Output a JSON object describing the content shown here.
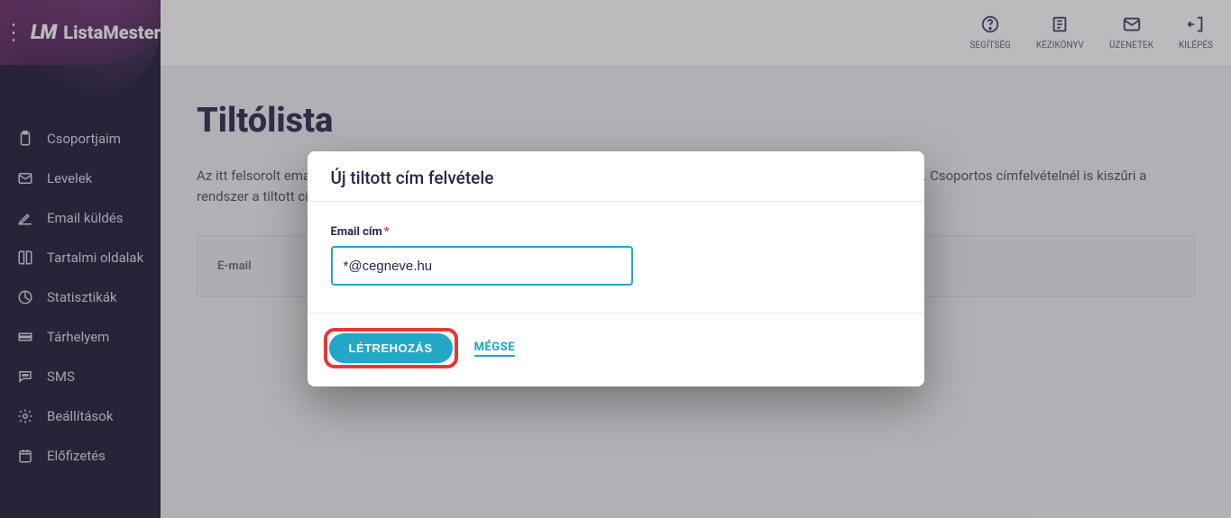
{
  "brand": {
    "logo_text": "LM",
    "name": "ListaMester"
  },
  "sidebar": {
    "items": [
      {
        "label": "Csoportjaim",
        "icon": "clipboard"
      },
      {
        "label": "Levelek",
        "icon": "mail"
      },
      {
        "label": "Email küldés",
        "icon": "send"
      },
      {
        "label": "Tartalmi oldalak",
        "icon": "book"
      },
      {
        "label": "Statisztikák",
        "icon": "chart"
      },
      {
        "label": "Tárhelyem",
        "icon": "storage"
      },
      {
        "label": "SMS",
        "icon": "chat"
      },
      {
        "label": "Beállítások",
        "icon": "gear"
      },
      {
        "label": "Előfizetés",
        "icon": "calendar"
      }
    ]
  },
  "topbar": {
    "items": [
      {
        "label": "SEGÍTSÉG",
        "icon": "help"
      },
      {
        "label": "KÉZIKÖNYV",
        "icon": "manual"
      },
      {
        "label": "ÜZENETEK",
        "icon": "mail"
      },
      {
        "label": "KILÉPÉS",
        "icon": "logout"
      }
    ]
  },
  "page": {
    "title": "Tiltólista",
    "description": "Az itt felsorolt emailcímek tiltva vannak. Az ilyen email címmel feliratkozó nem kap üzenetet, és nem kerül be a csoportba. Csoportos címfelvételnél is kiszűri a rendszer a tiltott címeket. *@konkurrencia.hu formájú email cím minden konkurrencia.hu-s email címet letilt.",
    "filter_label": "E-mail"
  },
  "modal": {
    "title": "Új tiltott cím felvétele",
    "field_label": "Email cím",
    "field_required": "*",
    "field_value": "*@cegneve.hu",
    "submit_label": "LÉTREHOZÁS",
    "cancel_label": "MÉGSE"
  }
}
